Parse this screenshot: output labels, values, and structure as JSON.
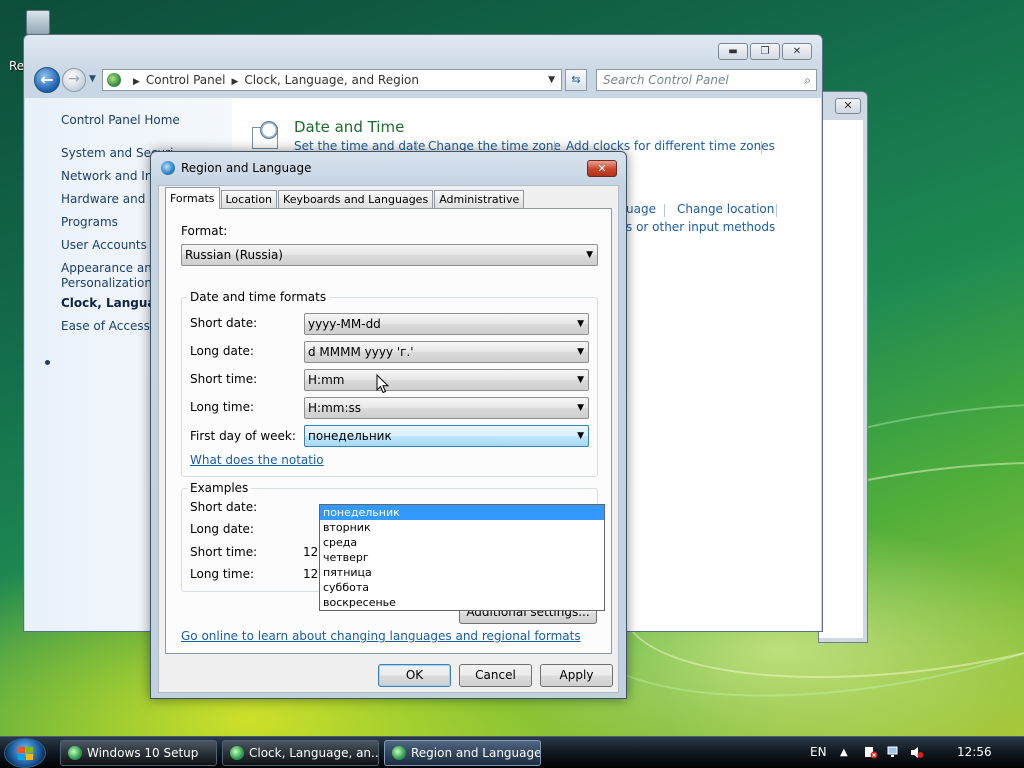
{
  "desktop": {
    "partial_label": "Re"
  },
  "control_panel": {
    "address": {
      "crumb_1": "Control Panel",
      "crumb_2": "Clock, Language, and Region"
    },
    "search_placeholder": "Search Control Panel",
    "left_nav": {
      "home": "Control Panel Home",
      "items": [
        "System and Securi",
        "Network and Inte",
        "Hardware and So",
        "Programs",
        "User Accounts",
        "Appearance and",
        "Personalization",
        "Clock, Language,",
        "Ease of Access"
      ]
    },
    "category": {
      "title": "Date and Time",
      "links": [
        "Set the time and date",
        "Change the time zone",
        "Add clocks for different time zones"
      ],
      "region_links_partial": [
        "uage",
        "Change location",
        "s or other input methods"
      ]
    }
  },
  "dialog": {
    "title": "Region and Language",
    "close_glyph": "✕",
    "tabs": [
      "Formats",
      "Location",
      "Keyboards and Languages",
      "Administrative"
    ],
    "format_label": "Format:",
    "format_value": "Russian (Russia)",
    "dt_group_title": "Date and time formats",
    "rows": [
      {
        "label": "Short date:",
        "value": "yyyy-MM-dd"
      },
      {
        "label": "Long date:",
        "value": "d MMMM yyyy 'г.'"
      },
      {
        "label": "Short time:",
        "value": "H:mm"
      },
      {
        "label": "Long time:",
        "value": "H:mm:ss"
      },
      {
        "label": "First day of week:",
        "value": "понедельник"
      }
    ],
    "notation_link": "What does the notatio",
    "dropdown_options": [
      "понедельник",
      "вторник",
      "среда",
      "четверг",
      "пятница",
      "суббота",
      "воскресенье"
    ],
    "examples_title": "Examples",
    "examples": [
      {
        "label": "Short date:",
        "value": ""
      },
      {
        "label": "Long date:",
        "value": ""
      },
      {
        "label": "Short time:",
        "value": "12:5"
      },
      {
        "label": "Long time:",
        "value": "12:56:39"
      }
    ],
    "additional_settings": "Additional settings...",
    "online_link": "Go online to learn about changing languages and regional formats",
    "ok": "OK",
    "cancel": "Cancel",
    "apply": "Apply"
  },
  "taskbar": {
    "items": [
      "Windows 10 Setup",
      "Clock, Language, an...",
      "Region and Language"
    ],
    "language": "EN",
    "clock": "12:56"
  }
}
